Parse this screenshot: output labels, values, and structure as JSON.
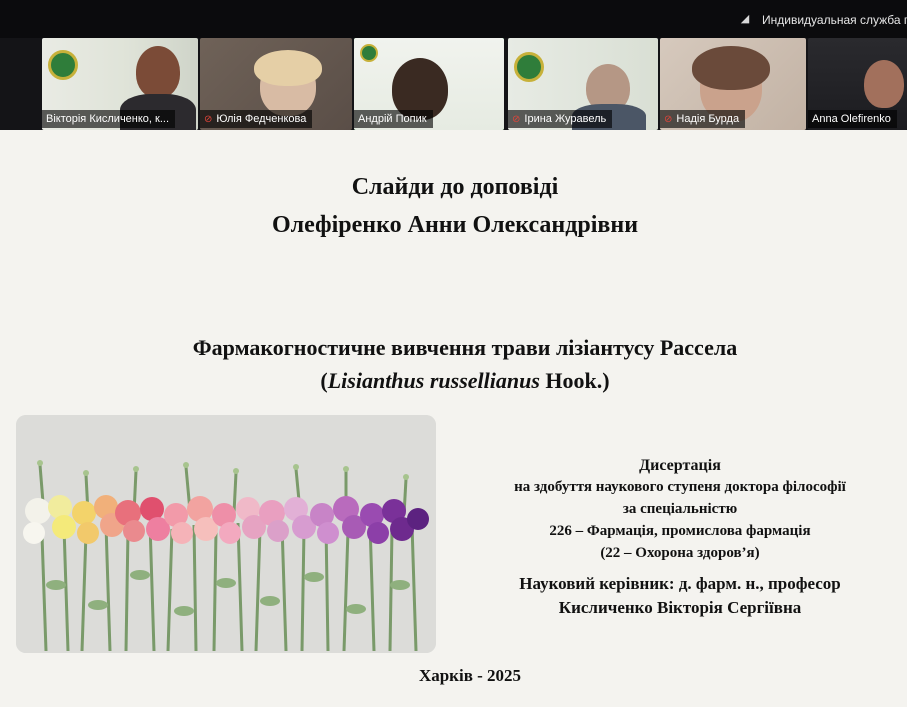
{
  "topbar": {
    "signal_icon": "signal-icon",
    "service_text": "Индивидуальная служба г"
  },
  "participants": [
    {
      "name": "Вікторія Кисличенко, к...",
      "muted": false
    },
    {
      "name": "Юлія Федченкова",
      "muted": true
    },
    {
      "name": "Андрій Попик",
      "muted": false
    },
    {
      "name": "Ірина Журавель",
      "muted": true
    },
    {
      "name": "Надія Бурда",
      "muted": true
    },
    {
      "name": "Anna Olefirenko",
      "muted": false
    }
  ],
  "slide": {
    "title_line1": "Слайди до доповіді",
    "title_line2": "Олефіренко Анни Олександрівни",
    "subtitle_line1": "Фармакогностичне вивчення трави лізіантусу Рассела",
    "subtitle_open": "(",
    "subtitle_latin": "Lisianthus russellianus",
    "subtitle_tail": " Hook.)",
    "info": {
      "line1": "Дисертація",
      "line2": "на здобуття наукового ступеня доктора філософії",
      "line3": "за спеціальністю",
      "line4": "226 – Фармація, промислова фармація",
      "line5": "(22 – Охорона здоров’я)",
      "supervisor1": "Науковий керівник: д. фарм. н., професор",
      "supervisor2": "Кисличенко Вікторія Сергіївна"
    },
    "city_year": "Харків - 2025"
  },
  "colors": {
    "mic_muted": "#e0453a",
    "active_speaker": "#36c24a",
    "slide_bg": "#f4f3ef"
  }
}
